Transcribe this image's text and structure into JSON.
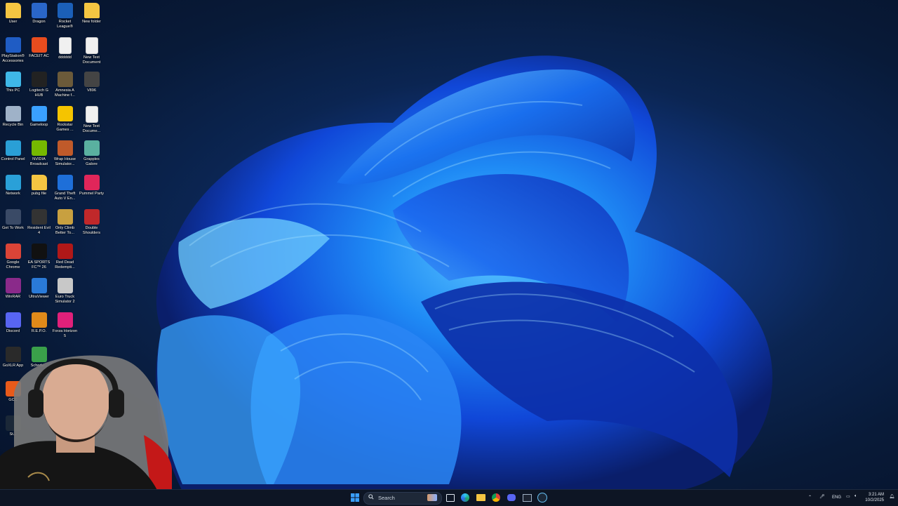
{
  "desktop": {
    "icons": [
      {
        "label": "User",
        "icon": "folder-icon",
        "color": "#f4c542"
      },
      {
        "label": "Dragon",
        "icon": "dragon-app-icon",
        "color": "#2a66c9"
      },
      {
        "label": "Rocket League®",
        "icon": "rocket-league-icon",
        "color": "#1b5fb8"
      },
      {
        "label": "New folder",
        "icon": "folder-icon",
        "color": "#f4c542"
      },
      {
        "label": "PlayStation® Accessories",
        "icon": "playstation-icon",
        "color": "#1f5cc4"
      },
      {
        "label": "FACEIT AC",
        "icon": "faceit-icon",
        "color": "#e84c1e"
      },
      {
        "label": "dddddd",
        "icon": "text-file-icon",
        "color": "#f0f0f0"
      },
      {
        "label": "New Text Document",
        "icon": "text-file-icon",
        "color": "#f0f0f0"
      },
      {
        "label": "This PC",
        "icon": "monitor-icon",
        "color": "#3fb8e8"
      },
      {
        "label": "Logitech G HUB",
        "icon": "logitech-icon",
        "color": "#222222"
      },
      {
        "label": "Amnesia A Machine f...",
        "icon": "amnesia-icon",
        "color": "#6b5a3a"
      },
      {
        "label": "V896",
        "icon": "v896-icon",
        "color": "#444444"
      },
      {
        "label": "Recycle Bin",
        "icon": "recycle-bin-icon",
        "color": "#9fb2c8"
      },
      {
        "label": "Gameloop",
        "icon": "gameloop-icon",
        "color": "#3aa0ff"
      },
      {
        "label": "Rockstar Games ...",
        "icon": "rockstar-icon",
        "color": "#f5c400"
      },
      {
        "label": "New Text Docume...",
        "icon": "text-file-icon",
        "color": "#f0f0f0"
      },
      {
        "label": "Control Panel",
        "icon": "control-panel-icon",
        "color": "#2a9fd6"
      },
      {
        "label": "NVIDIA Broadcast",
        "icon": "nvidia-icon",
        "color": "#76b900"
      },
      {
        "label": "Wrap House Simulator...",
        "icon": "wrap-house-icon",
        "color": "#c05a2a"
      },
      {
        "label": "Grapples Galore",
        "icon": "grapples-icon",
        "color": "#5ab0a0"
      },
      {
        "label": "Network",
        "icon": "network-icon",
        "color": "#2aa0d8"
      },
      {
        "label": "pubg file",
        "icon": "folder-icon",
        "color": "#f4c542"
      },
      {
        "label": "Grand Theft Auto V En...",
        "icon": "gta-icon",
        "color": "#1e6fd9"
      },
      {
        "label": "Pummel Party",
        "icon": "pummel-party-icon",
        "color": "#e0265a"
      },
      {
        "label": "Get To Work",
        "icon": "get-to-work-icon",
        "color": "#3a4a66"
      },
      {
        "label": "Resident Evil 4",
        "icon": "resident-evil-icon",
        "color": "#333333"
      },
      {
        "label": "Only Climb Better To...",
        "icon": "only-climb-icon",
        "color": "#c8a040"
      },
      {
        "label": "Double Shoulders",
        "icon": "double-shoulders-icon",
        "color": "#c0282a"
      },
      {
        "label": "Google Chrome",
        "icon": "chrome-icon",
        "color": "#db4437"
      },
      {
        "label": "EA SPORTS FC™ 26",
        "icon": "ea-sports-icon",
        "color": "#111111"
      },
      {
        "label": "Red Dead Redempti...",
        "icon": "red-dead-icon",
        "color": "#b01818"
      },
      {
        "label": "",
        "icon": "",
        "color": ""
      },
      {
        "label": "WinRAR",
        "icon": "winrar-icon",
        "color": "#8a2a8a"
      },
      {
        "label": "UltraViewer",
        "icon": "ultraviewer-icon",
        "color": "#2a7ad8"
      },
      {
        "label": "Euro Truck Simulator 2",
        "icon": "euro-truck-icon",
        "color": "#c8c8c8"
      },
      {
        "label": "",
        "icon": "",
        "color": ""
      },
      {
        "label": "Discord",
        "icon": "discord-icon",
        "color": "#5865f2"
      },
      {
        "label": "R.E.P.O.",
        "icon": "repo-icon",
        "color": "#e08a1a"
      },
      {
        "label": "Forza Horizon 5",
        "icon": "forza-icon",
        "color": "#e0207a"
      },
      {
        "label": "",
        "icon": "",
        "color": ""
      },
      {
        "label": "GoXLR App",
        "icon": "goxlr-icon",
        "color": "#2a2a2a"
      },
      {
        "label": "Schedu...",
        "icon": "schedule-icon",
        "color": "#3aa04a"
      },
      {
        "label": "",
        "icon": "",
        "color": ""
      },
      {
        "label": "",
        "icon": "",
        "color": ""
      },
      {
        "label": "GCC",
        "icon": "gcc-icon",
        "color": "#e85a1a"
      },
      {
        "label": "",
        "icon": "",
        "color": ""
      },
      {
        "label": "",
        "icon": "",
        "color": ""
      },
      {
        "label": "",
        "icon": "",
        "color": ""
      },
      {
        "label": "St...",
        "icon": "steam-icon",
        "color": "#1b2838"
      }
    ]
  },
  "taskbar": {
    "search_label": "Search",
    "apps": [
      "start-icon",
      "search-icon",
      "edge-icon",
      "file-explorer-icon",
      "chrome-icon",
      "discord-icon",
      "terminal-icon",
      "steam-icon"
    ],
    "tray": {
      "language": "ENG",
      "time": "3:21 AM",
      "date": "10/2/2025"
    }
  },
  "colors": {
    "accent": "#1d5fe0",
    "taskbar_bg": "#0d1524"
  }
}
